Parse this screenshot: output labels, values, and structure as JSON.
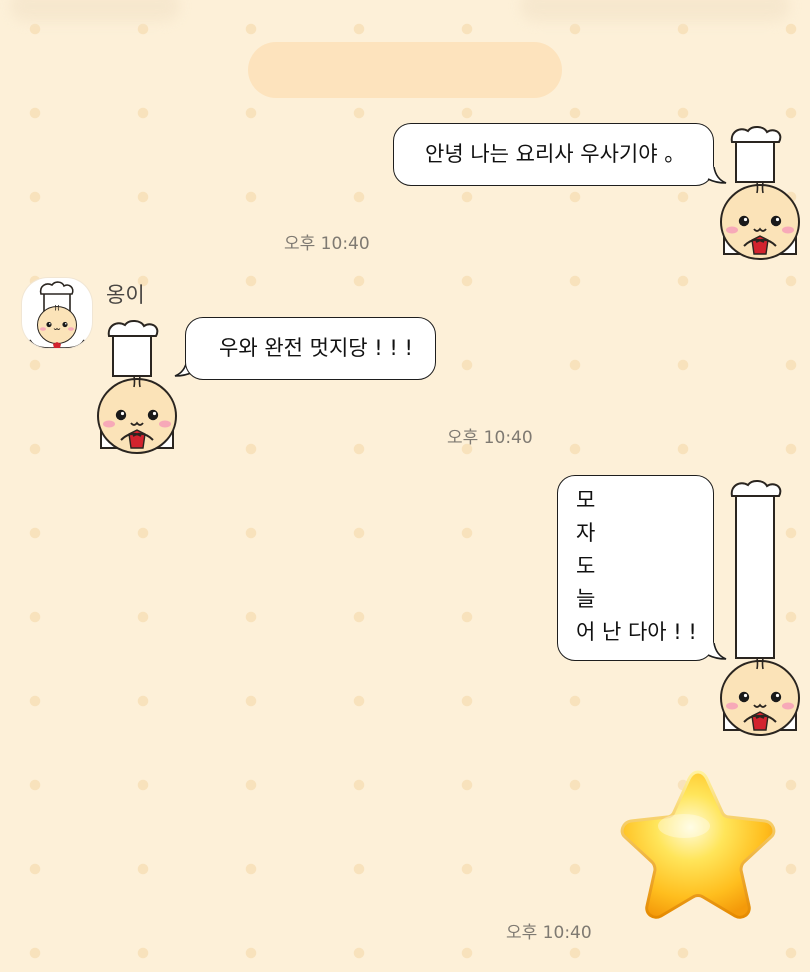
{
  "chat": {
    "messages": [
      {
        "sender": "me",
        "text": "안녕 나는 요리사 우사기야 。",
        "time": "오후 10:40"
      },
      {
        "sender": "옹이",
        "text": "우와 완전 멋지당 ! ! !",
        "time": "오후 10:40"
      },
      {
        "sender": "me",
        "lines": [
          "모",
          "자",
          "도",
          "늘",
          "어 난 다아 ! !"
        ],
        "time": "오후 10:40"
      },
      {
        "sender": "me",
        "emoji": "star",
        "time": "오후 10:40"
      }
    ]
  },
  "colors": {
    "background": "#fdf0d8",
    "dot": "#f8e2bc",
    "date_pill": "#fde3bd",
    "bubble": "#ffffff",
    "bubble_border": "#1e1e1e",
    "time_text": "#7f7a72"
  },
  "icons": {
    "avatar": "chef-bun-avatar",
    "sticker": "chef-bun-sticker",
    "emoji": "star-emoji"
  }
}
